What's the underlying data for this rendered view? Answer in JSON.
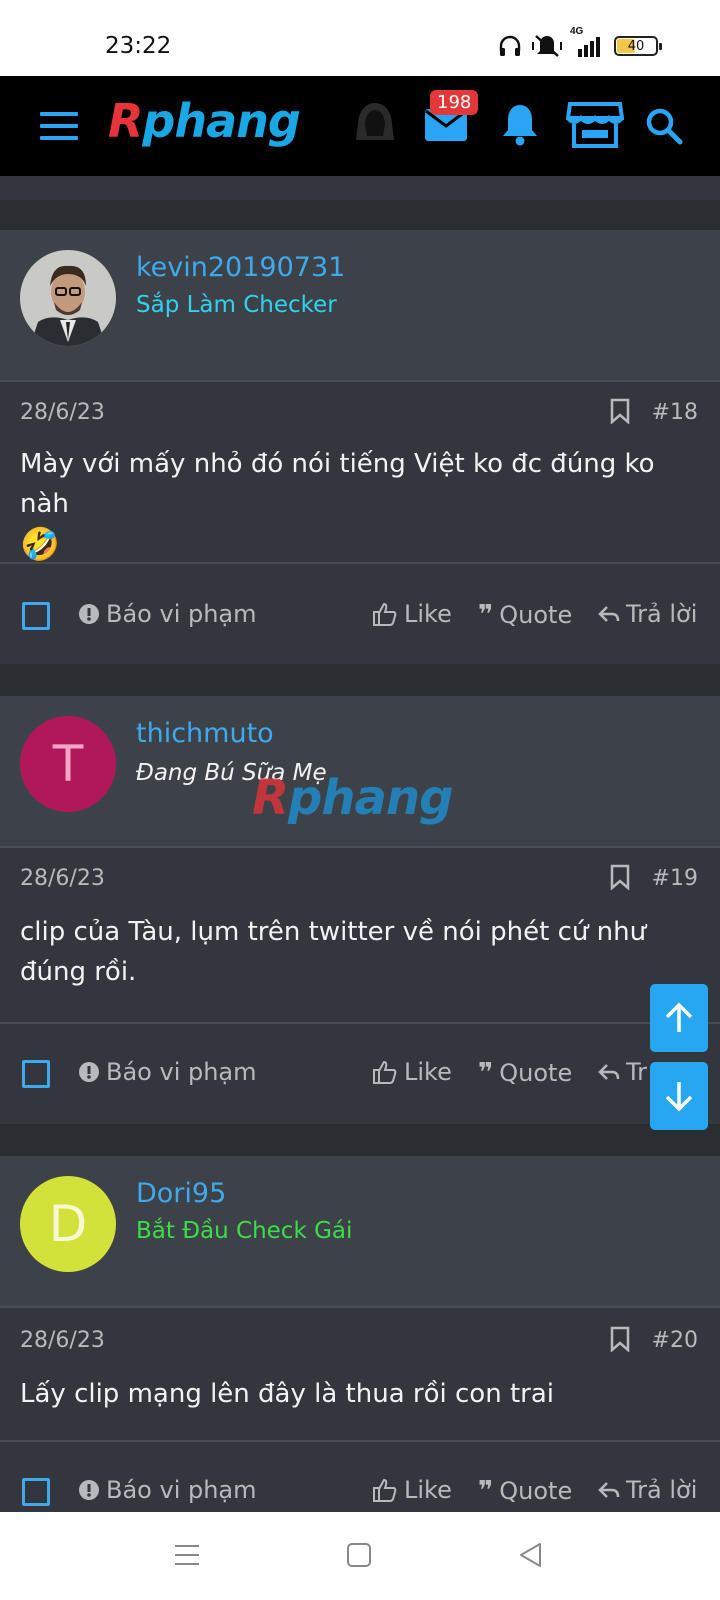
{
  "status_bar": {
    "time": "23:22",
    "network": "4G",
    "battery": "40"
  },
  "header": {
    "logo_first": "R",
    "logo_rest": "phang",
    "mail_badge": "198",
    "icons": [
      "menu-icon",
      "hooded-user-icon",
      "mail-icon",
      "bell-icon",
      "store-icon",
      "search-icon"
    ]
  },
  "posts": [
    {
      "username": "kevin20190731",
      "user_title": "Sắp Làm Checker",
      "date": "28/6/23",
      "number": "#18",
      "content": "Mày với mấy nhỏ đó nói tiếng Việt ko đc đúng ko nàh",
      "emoji": "🤣"
    },
    {
      "avatar_letter": "T",
      "username": "thichmuto",
      "user_title": "Đang Bú Sữa Mẹ",
      "date": "28/6/23",
      "number": "#19",
      "content": "clip của Tàu, lụm trên twitter về nói phét cứ như đúng rồi."
    },
    {
      "avatar_letter": "D",
      "username": "Dori95",
      "user_title": "Bắt Đầu Check Gái",
      "date": "28/6/23",
      "number": "#20",
      "content": "Lấy clip mạng lên đây là thua rồi con trai"
    }
  ],
  "actions": {
    "report": "Báo vi phạm",
    "like": "Like",
    "quote": "Quote",
    "reply": "Trả lời",
    "reply_truncated": "Tr"
  },
  "watermark": {
    "first": "R",
    "rest": "phang"
  },
  "colors": {
    "accent": "#26a7f0",
    "title_cyan": "#2fd3f0",
    "title_green": "#3ddc4a",
    "avatar_t": "#b0185a",
    "avatar_d": "#d3e23a"
  }
}
